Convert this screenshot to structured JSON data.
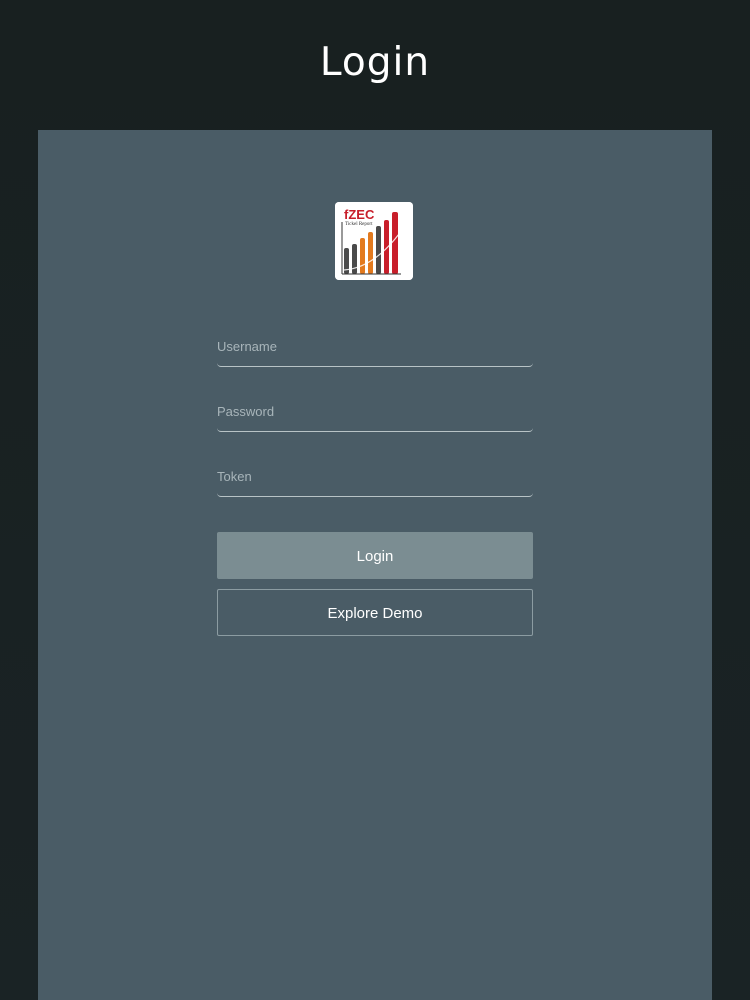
{
  "header": {
    "title": "Login"
  },
  "logo": {
    "text": "fZEC",
    "subtitle": "Tickel Report",
    "colors": [
      "#4a4a4a",
      "#e37a1e",
      "#c81e2a"
    ]
  },
  "form": {
    "username": {
      "placeholder": "Username",
      "value": ""
    },
    "password": {
      "placeholder": "Password",
      "value": ""
    },
    "token": {
      "placeholder": "Token",
      "value": ""
    }
  },
  "buttons": {
    "login_label": "Login",
    "demo_label": "Explore Demo"
  },
  "colors": {
    "background": "#1b2223",
    "panel": "#4a5c66",
    "login_button": "#7b8d92"
  }
}
